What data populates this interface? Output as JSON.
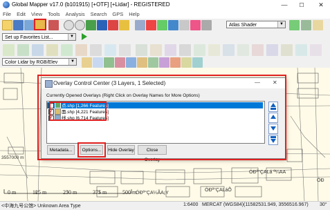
{
  "window": {
    "title": "Global Mapper v17.0 (b101915) [+OTF] [+Lidar] - REGISTERED",
    "minimize": "—",
    "maximize": "☐",
    "close": "✕"
  },
  "menu": [
    "File",
    "Edit",
    "View",
    "Tools",
    "Analysis",
    "Search",
    "GPS",
    "Help"
  ],
  "toolbar": {
    "favorites_placeholder": "Set up Favorites List...",
    "shader_value": "Atlas Shader",
    "lidar_color_value": "Color Lidar by RGB/Elev"
  },
  "map": {
    "coord_label": "3557000 m",
    "scale_labels": [
      "0 m",
      "125 m",
      "250 m",
      "375 m",
      "500 m"
    ],
    "place_label_1": "ÓÐª°ÇALá ª¼AA",
    "place_label_2": "ÓÐª°ÇALáÕ",
    "place_label_3": "ÓÐ",
    "place_label_4": "ÓÐª°ÇA¼ÃA¡Y"
  },
  "statusbar": {
    "left": "<中海九号公馆> Unknown Area Type",
    "scale": "1:6400",
    "projection": "MERCAT (WGS84)",
    "coords": "(11582531.949, 3556516.967)",
    "extra": "30°"
  },
  "dialog": {
    "title": "Overlay Control Center (3 Layers, 1 Selected)",
    "list_header": "Currently Opened Overlays (Right Click on Overlay Names for More Options)",
    "layers": [
      {
        "label": "点.shp [1,266 Features]",
        "selected": true
      },
      {
        "label": "面.shp [4,221 Features]",
        "selected": false
      },
      {
        "label": "线.shp [6,714 Features]",
        "selected": false
      }
    ],
    "buttons": {
      "metadata": "Metadata...",
      "options": "Options...",
      "hide_overlay": "Hide Overlay",
      "close_overlay": "Close Overlay"
    },
    "minimize": "—",
    "close": "✕"
  },
  "colors": {
    "highlight": "#e12020",
    "selection": "#0078d7",
    "map_bg": "#fffbe8"
  }
}
